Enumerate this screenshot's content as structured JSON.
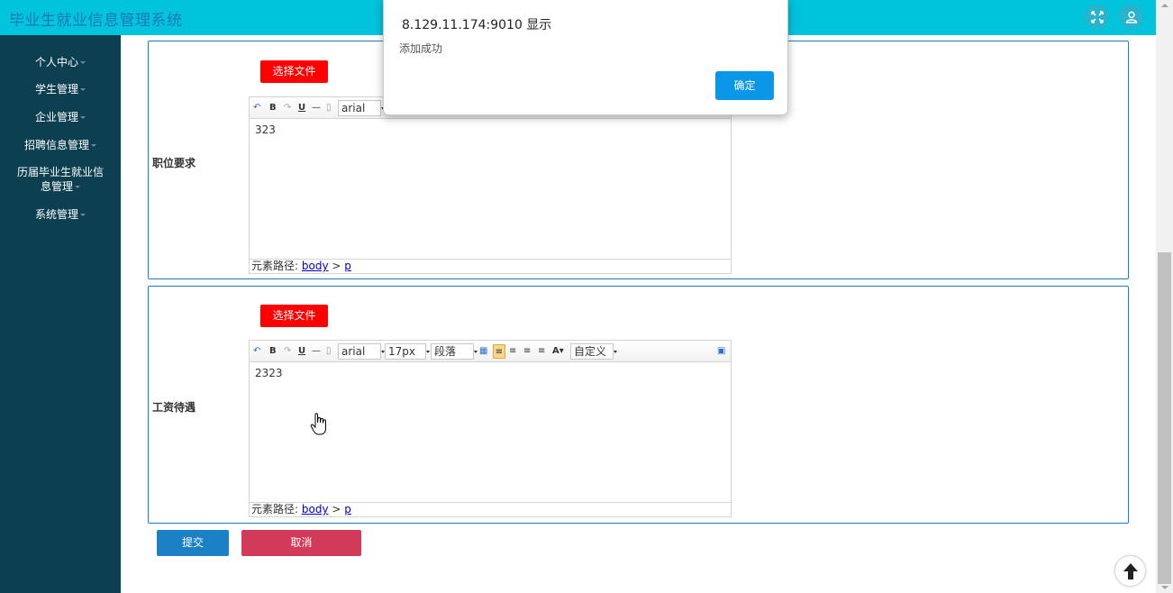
{
  "app": {
    "title": "毕业生就业信息管理系统"
  },
  "header": {
    "icons": [
      "fullscreen-icon",
      "user-icon"
    ]
  },
  "sidebar": {
    "items": [
      {
        "label": "个人中心"
      },
      {
        "label": "学生管理"
      },
      {
        "label": "企业管理"
      },
      {
        "label": "招聘信息管理"
      },
      {
        "label": "历届毕业生就业信息管理",
        "line1": "历届毕业生就业信",
        "line2": "息管理"
      },
      {
        "label": "系统管理"
      }
    ]
  },
  "form": {
    "fields": [
      {
        "label": "职位要求",
        "file_button": "选择文件",
        "font": "arial",
        "content": "323",
        "path_label": "元素路径:",
        "path_body": "body",
        "path_sep": ">",
        "path_p": "p"
      },
      {
        "label": "工资待遇",
        "file_button": "选择文件",
        "font": "arial",
        "font_size": "17px",
        "paragraph": "段落",
        "custom": "自定义",
        "content": "2323",
        "path_label": "元素路径:",
        "path_body": "body",
        "path_sep": ">",
        "path_p": "p"
      }
    ],
    "submit_label": "提交",
    "cancel_label": "取消"
  },
  "dialog": {
    "title": "8.129.11.174:9010 显示",
    "message": "添加成功",
    "ok_label": "确定"
  },
  "colors": {
    "header": "#00c3dc",
    "sidebar": "#0c3f50",
    "panel_border": "#1b80c4",
    "file_button": "#ff0000",
    "submit": "#1b80c4",
    "cancel": "#d23a5a",
    "dialog_ok": "#0a97e8"
  }
}
